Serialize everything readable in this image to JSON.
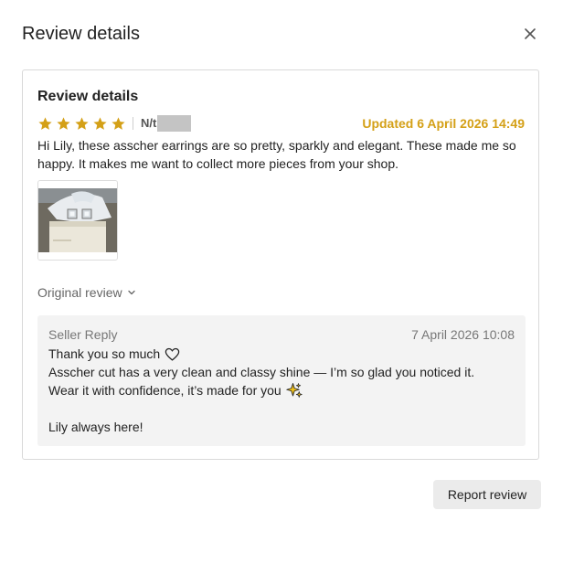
{
  "modal": {
    "title": "Review details",
    "close_icon": "close-icon"
  },
  "review": {
    "card_title": "Review details",
    "rating": 5,
    "rating_max": 5,
    "star_color": "#d4a017",
    "reviewer_name": "N/t",
    "updated_text": "Updated 6 April 2026 14:49",
    "text": "Hi Lily, these asscher earrings are so pretty, sparkly and elegant. These made me so happy. It makes me want to collect more pieces from your shop.",
    "original_review_label": "Original review"
  },
  "seller_reply": {
    "label": "Seller Reply",
    "timestamp": "7 April 2026 10:08",
    "line1": "Thank you so much",
    "line1_icon": "heart-outline-icon",
    "line2": "Asscher cut has a very clean and classy shine — I’m so glad you noticed it.",
    "line3": "Wear it with confidence, it’s made for you",
    "line3_icon": "sparkles-icon",
    "line4": "",
    "line5": "Lily always here!"
  },
  "actions": {
    "report_label": "Report review"
  }
}
